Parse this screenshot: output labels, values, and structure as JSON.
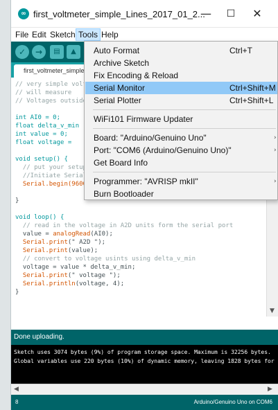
{
  "window": {
    "title": "first_voltmeter_simple_Lines_2017_01_2...",
    "app_icon": "∞",
    "minimize": "—",
    "maximize": "☐",
    "close": "✕"
  },
  "menubar": {
    "file": "File",
    "edit": "Edit",
    "sketch": "Sketch",
    "tools": "Tools",
    "help": "Help"
  },
  "toolbar": {
    "verify_icon": "✓",
    "upload_icon": "→",
    "new_icon": "▤",
    "open_icon": "▲"
  },
  "tab": {
    "label": "first_voltmeter_simple_Lines"
  },
  "code": {
    "l1": "// very simple voltmeter",
    "l2": "// will measure",
    "l3": "// Voltages outside",
    "l4": "int AI0 = 0;",
    "l5": "float delta_v_min",
    "l6": "int value = 0;",
    "l7": "float voltage =",
    "l8": "void setup() {",
    "l9": "  // put your setup",
    "l10": "  //Initiate Serial",
    "l11": "  Serial.begin(9600",
    "l12": "}",
    "l13": "void loop() {",
    "l14": "  // read in the voltage in A2D units form the serial port",
    "l15a": "  value = ",
    "l15b": "analogRead",
    "l15c": "(AI0);",
    "l16a": "  Serial.",
    "l16b": "print",
    "l16c": "(\" A2D \");",
    "l17a": "  Serial.",
    "l17b": "print",
    "l17c": "(value);",
    "l18": "  // convert to voltage usints using delta_v_min",
    "l19": "  voltage = value * delta_v_min;",
    "l20a": "  Serial.",
    "l20b": "print",
    "l20c": "(\" voltage \");",
    "l21a": "  Serial.",
    "l21b": "println",
    "l21c": "(voltage, 4);",
    "l22": "}"
  },
  "status": {
    "message": "Done uploading."
  },
  "console": {
    "line1": "Sketch uses 3074 bytes (9%) of program storage space. Maximum is 32256 bytes.",
    "line2": "Global variables use 220 bytes (10%) of dynamic memory, leaving 1828 bytes for local variables."
  },
  "bottom": {
    "line_number": "8",
    "board_port": "Arduino/Genuino Uno on COM6"
  },
  "tools_menu": {
    "items": [
      {
        "label": "Auto Format",
        "shortcut": "Ctrl+T",
        "highlighted": false
      },
      {
        "label": "Archive Sketch",
        "shortcut": "",
        "highlighted": false
      },
      {
        "label": "Fix Encoding & Reload",
        "shortcut": "",
        "highlighted": false
      },
      {
        "label": "Serial Monitor",
        "shortcut": "Ctrl+Shift+M",
        "highlighted": true
      },
      {
        "label": "Serial Plotter",
        "shortcut": "Ctrl+Shift+L",
        "highlighted": false
      },
      {
        "label": "WiFi101 Firmware Updater",
        "shortcut": "",
        "highlighted": false
      },
      {
        "label": "Board: \"Arduino/Genuino Uno\"",
        "shortcut": "",
        "submenu": true
      },
      {
        "label": "Port: \"COM6 (Arduino/Genuino Uno)\"",
        "shortcut": "",
        "submenu": true
      },
      {
        "label": "Get Board Info",
        "shortcut": "",
        "highlighted": false
      },
      {
        "label": "Programmer: \"AVRISP mkII\"",
        "shortcut": "",
        "submenu": true
      },
      {
        "label": "Burn Bootloader",
        "shortcut": "",
        "highlighted": false
      }
    ],
    "submenu_arrow": "›"
  },
  "colors": {
    "teal_dark": "#006468",
    "teal_mid": "#17a1a5",
    "menu_highlight": "#91c9f7"
  }
}
